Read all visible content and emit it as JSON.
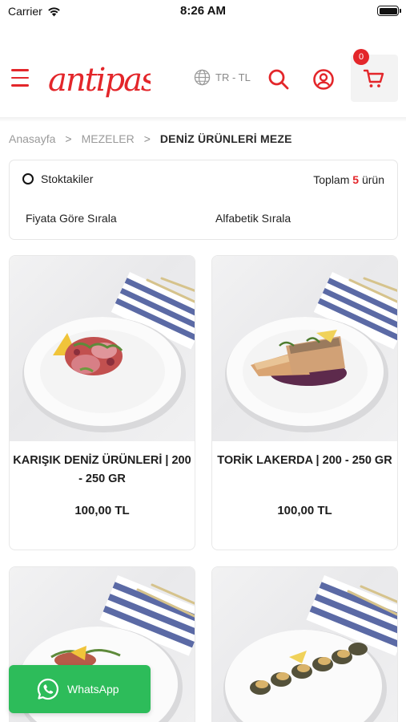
{
  "status_bar": {
    "carrier": "Carrier",
    "time": "8:26 AM"
  },
  "header": {
    "logo_text": "antipasto",
    "language": "TR - TL",
    "cart_count": "0",
    "brand_color": "#e3262a"
  },
  "breadcrumb": {
    "home": "Anasayfa",
    "category": "MEZELER",
    "current": "DENİZ ÜRÜNLERİ MEZE",
    "separator": ">"
  },
  "filters": {
    "stock_label": "Stoktakiler",
    "total_prefix": "Toplam",
    "total_count": "5",
    "total_suffix": "ürün",
    "sort_price": "Fiyata Göre Sırala",
    "sort_alpha": "Alfabetik Sırala"
  },
  "products": [
    {
      "name": "KARIŞIK DENİZ ÜRÜNLERİ | 200 - 250 GR",
      "price": "100,00 TL",
      "dish": "mixed-seafood"
    },
    {
      "name": "TORİK LAKERDA | 200 - 250 GR",
      "price": "100,00 TL",
      "dish": "torik-lakerda"
    },
    {
      "name": "",
      "price": "",
      "dish": "octopus-salad"
    },
    {
      "name": "",
      "price": "",
      "dish": "stuffed-mussels"
    }
  ],
  "whatsapp": {
    "label": "WhatsApp",
    "color": "#2dbc5a"
  },
  "icons": {
    "menu": "hamburger-menu-icon",
    "language": "globe-icon",
    "search": "search-icon",
    "user": "user-account-icon",
    "cart": "shopping-cart-icon",
    "whatsapp": "whatsapp-icon"
  }
}
